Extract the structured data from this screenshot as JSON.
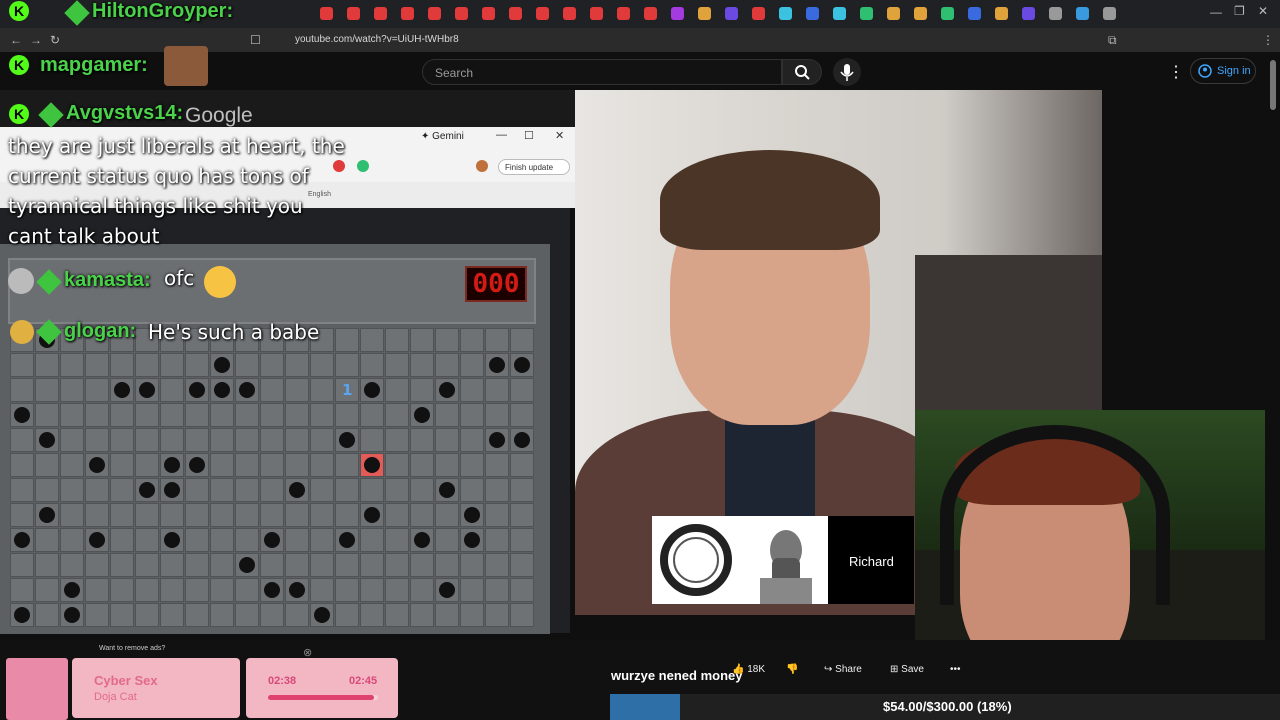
{
  "browser": {
    "url": "youtube.com/watch?v=UiUH-tWHbr8",
    "tab_colors": [
      "#e03a3a",
      "#e03a3a",
      "#e03a3a",
      "#e03a3a",
      "#e03a3a",
      "#e03a3a",
      "#e03a3a",
      "#e03a3a",
      "#e03a3a",
      "#e03a3a",
      "#e03a3a",
      "#e03a3a",
      "#e03a3a",
      "#a33be0",
      "#e0a23a",
      "#6a4ae0",
      "#e03a3a",
      "#3ac2e0",
      "#3a6ae0",
      "#3ac2e0",
      "#2fbf71",
      "#e0a23a",
      "#e0a23a",
      "#2fbf71",
      "#3a6ae0",
      "#e0a23a",
      "#6a4ae0",
      "#999999",
      "#3a9ae0",
      "#999999"
    ]
  },
  "youtube": {
    "search_placeholder": "Search",
    "sign_in": "Sign in",
    "lower_third_name": "Richard",
    "video_title": "wurzye nened money",
    "likes": "18K",
    "share": "Share",
    "save": "Save"
  },
  "gemini": {
    "title": "✦ Gemini",
    "finish_update": "Finish update",
    "lang": "English"
  },
  "minesweeper": {
    "counter": "000"
  },
  "chat": {
    "line1_name": "HiltonGroyper:",
    "line2_name": "mapgamer:",
    "line3_name": "Avgvstvs14:",
    "ghost": "Google",
    "line3_msg": "they are just liberals at heart, the current status quo has tons of tyrannical things like shit you cant talk about",
    "line4_name": "kamasta:",
    "line4_msg": "ofc",
    "line5_name": "glogan:",
    "line5_msg": "He's such a babe"
  },
  "music": {
    "ad_note": "Want to remove ads?",
    "song": "Cyber Sex",
    "artist": "Doja Cat",
    "elapsed": "02:38",
    "total": "02:45",
    "progress_fraction": 0.96
  },
  "goal": {
    "text": "$54.00/$300.00 (18%)",
    "fraction": 0.18
  }
}
